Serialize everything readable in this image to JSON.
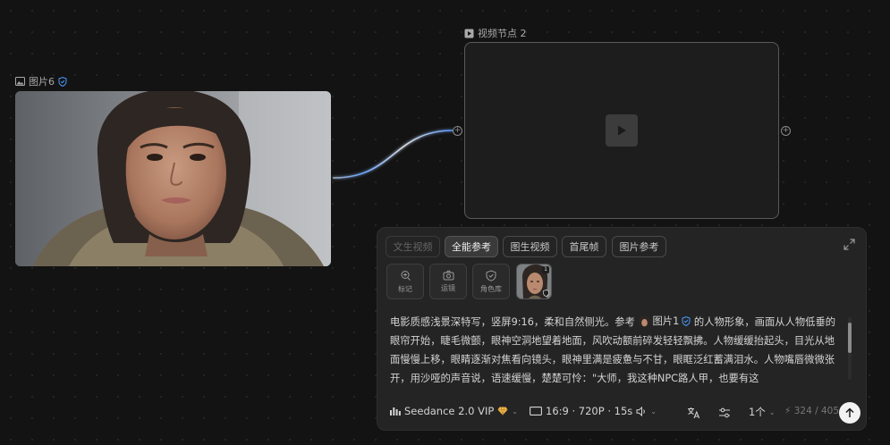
{
  "canvas": {
    "image_node": {
      "label": "图片6"
    },
    "video_node": {
      "label": "视频节点 2"
    }
  },
  "panel": {
    "tabs": [
      {
        "label": "文生视频",
        "state": "disabled"
      },
      {
        "label": "全能参考",
        "state": "active"
      },
      {
        "label": "图生视频",
        "state": "normal"
      },
      {
        "label": "首尾帧",
        "state": "normal"
      },
      {
        "label": "图片参考",
        "state": "normal"
      }
    ],
    "tools": [
      {
        "label": "标记",
        "icon": "marker-plus-icon"
      },
      {
        "label": "运镜",
        "icon": "camera-icon"
      },
      {
        "label": "角色库",
        "icon": "shield-icon"
      }
    ],
    "reference": {
      "badge": "1"
    },
    "prompt": {
      "part1": "电影质感浅景深特写，竖屏9:16，柔和自然侧光。参考",
      "mention": "图片1",
      "part2": "的人物形象，画面从人物低垂的眼帘开始，睫毛微颤，眼神空洞地望着地面，风吹动额前碎发轻轻飘拂。人物缓缓抬起头，目光从地面慢慢上移，眼睛逐渐对焦看向镜头，眼神里满是疲惫与不甘，眼眶泛红蓄满泪水。人物嘴唇微微张开，用沙哑的声音说，语速缓慢，楚楚可怜：\"大师，我这种NPC路人甲，也要有这"
    },
    "footer": {
      "model": "Seedance 2.0 VIP",
      "settings": "16:9 · 720P · 15s",
      "count": "1个",
      "counter": "324 / 405"
    }
  },
  "colors": {
    "background": "#131313",
    "panel": "#242424",
    "accent_blue": "#3d8bff",
    "vip_gold": "#f0b84a"
  }
}
